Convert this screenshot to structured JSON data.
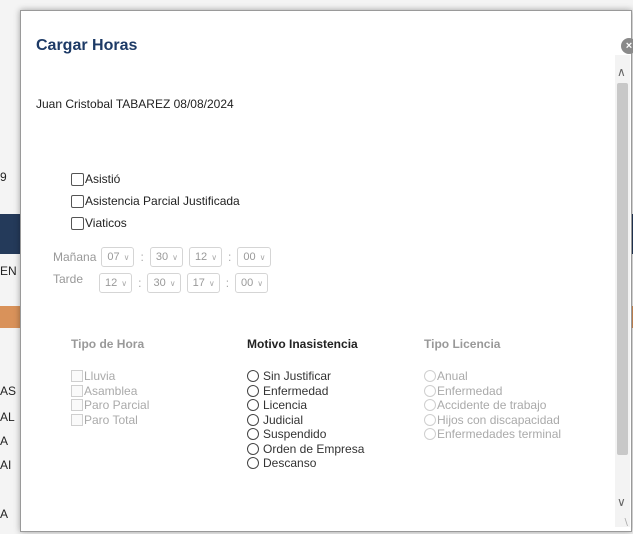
{
  "background": {
    "text_fragments": [
      "9",
      "EN",
      "AS",
      "AL",
      "A",
      "AI",
      "A"
    ],
    "band_colors": {
      "dark": "#243a5a",
      "orange": "#d9925a"
    }
  },
  "modal": {
    "title": "Cargar Horas",
    "close_label": "×",
    "employee_line": "Juan Cristobal TABAREZ  08/08/2024",
    "checkboxes": [
      "Asistió",
      "Asistencia Parcial Justificada",
      "Viaticos"
    ],
    "time": {
      "morning_label": "Mañana",
      "afternoon_label": "Tarde",
      "morning": {
        "h1": "07",
        "m1": "30",
        "h2": "12",
        "m2": "00"
      },
      "afternoon": {
        "h1": "12",
        "m1": "30",
        "h2": "17",
        "m2": "00"
      },
      "separator": ":"
    },
    "tipo_hora": {
      "heading": "Tipo de Hora",
      "options": [
        "Lluvia",
        "Asamblea",
        "Paro Parcial",
        "Paro Total"
      ]
    },
    "motivo": {
      "heading": "Motivo Inasistencia",
      "options": [
        "Sin Justificar",
        "Enfermedad",
        "Licencia",
        "Judicial",
        "Suspendido",
        "Orden de Empresa",
        "Descanso"
      ]
    },
    "tipo_licencia": {
      "heading": "Tipo Licencia",
      "options": [
        "Anual",
        "Enfermedad",
        "Accidente de trabajo",
        "Hijos con discapacidad",
        "Enfermedades terminal"
      ]
    }
  },
  "colors": {
    "title": "#1d3a66",
    "disabled": "#aaaaaa"
  }
}
